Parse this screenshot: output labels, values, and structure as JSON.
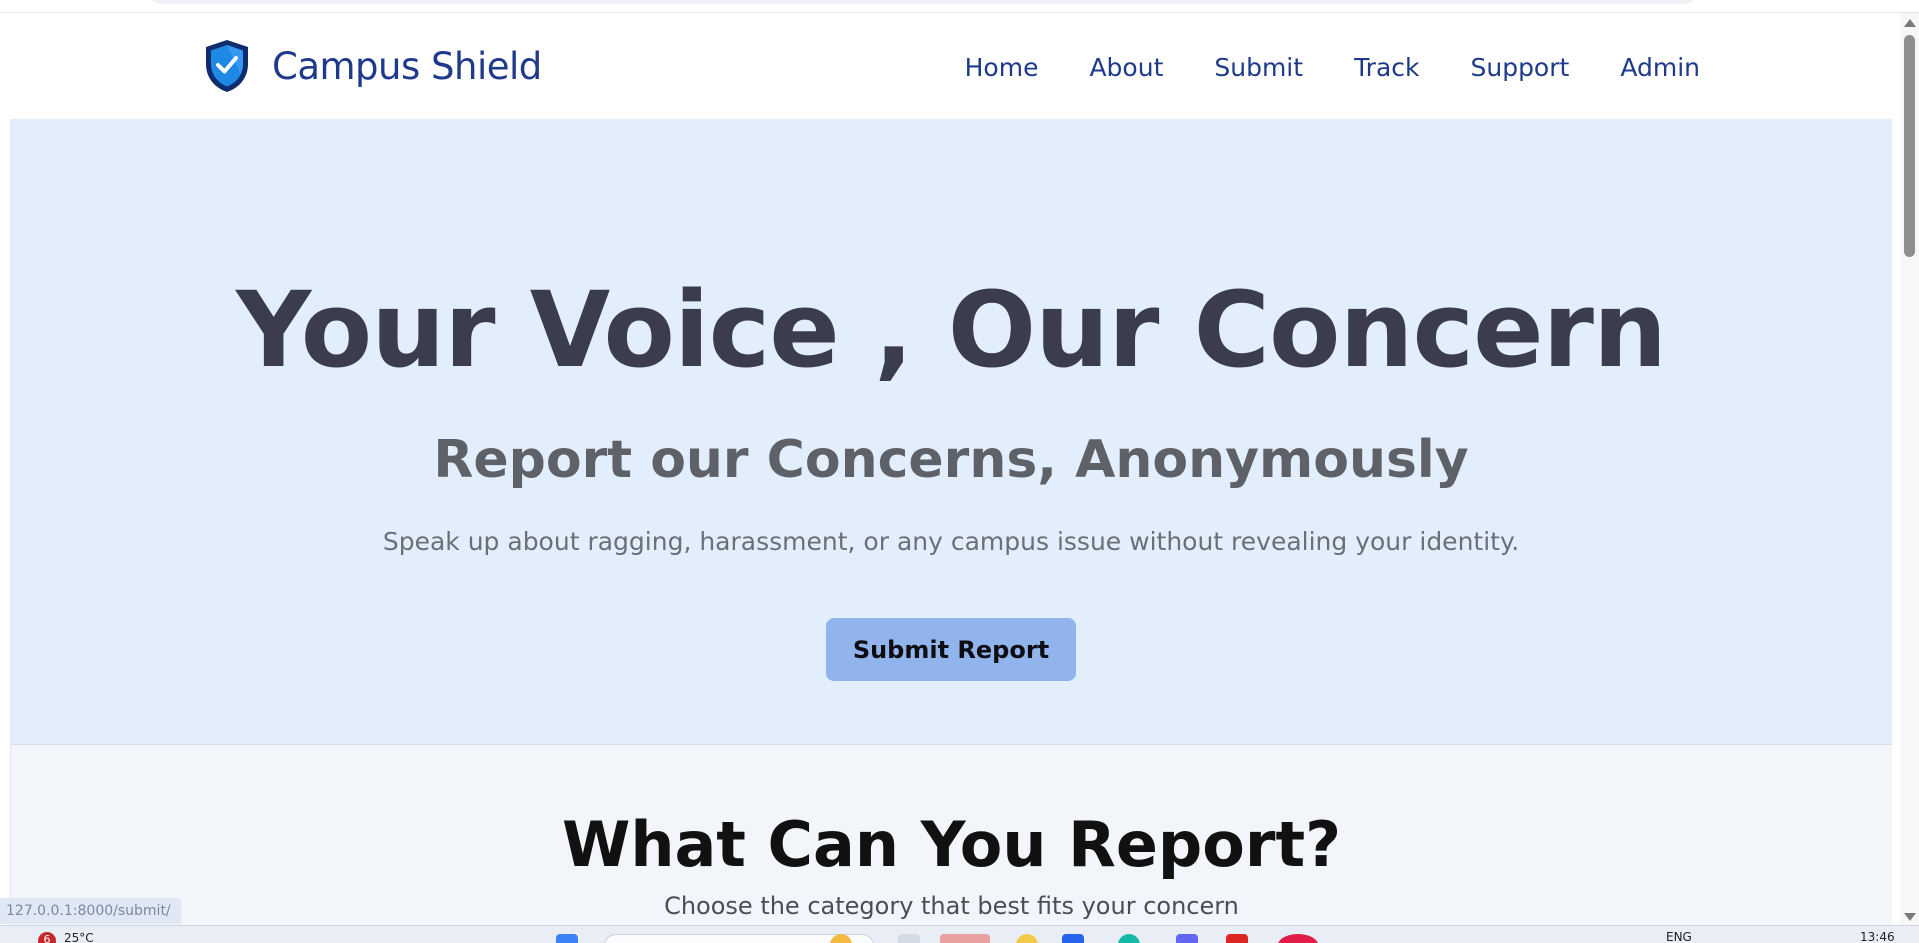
{
  "brand": {
    "name": "Campus Shield",
    "logo_icon": "shield-check-icon"
  },
  "nav": {
    "items": [
      {
        "label": "Home"
      },
      {
        "label": "About"
      },
      {
        "label": "Submit"
      },
      {
        "label": "Track"
      },
      {
        "label": "Support"
      },
      {
        "label": "Admin"
      }
    ]
  },
  "hero": {
    "title": "Your Voice , Our Concern",
    "subtitle": "Report our Concerns, Anonymously",
    "description": "Speak up about ragging, harassment, or any campus issue without revealing your identity.",
    "cta_label": "Submit Report"
  },
  "categories": {
    "title": "What Can You Report?",
    "subtitle": "Choose the category that best fits your concern"
  },
  "status_bar": {
    "url": "127.0.0.1:8000/submit/"
  },
  "taskbar": {
    "weather_badge": "6",
    "temperature": "25°C",
    "language": "ENG",
    "time": "13:46"
  },
  "colors": {
    "accent": "#1e3a8a",
    "hero_bg": "#e3eefc",
    "cta_bg": "#92b4ec",
    "section_bg": "#f2f5f9"
  }
}
